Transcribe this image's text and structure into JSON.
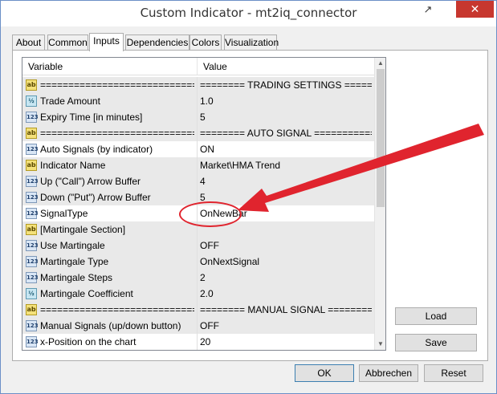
{
  "window": {
    "title": "Custom Indicator - mt2iq_connector",
    "pin_glyph": "↗",
    "close_glyph": "✕"
  },
  "tabs": [
    {
      "label": "About"
    },
    {
      "label": "Common"
    },
    {
      "label": "Inputs"
    },
    {
      "label": "Dependencies"
    },
    {
      "label": "Colors"
    },
    {
      "label": "Visualization"
    }
  ],
  "active_tab": "Inputs",
  "grid": {
    "headers": {
      "variable": "Variable",
      "value": "Value"
    },
    "rows": [
      {
        "icon": "ab",
        "icon_name": "text-type-icon",
        "variable": "================================",
        "value": "======== TRADING SETTINGS ========"
      },
      {
        "icon": "½",
        "icon_name": "double-type-icon",
        "variable": "Trade Amount",
        "value": "1.0"
      },
      {
        "icon": "123",
        "icon_name": "integer-type-icon",
        "variable": "Expiry Time [in minutes]",
        "value": "5"
      },
      {
        "icon": "ab",
        "icon_name": "text-type-icon",
        "variable": "================================",
        "value": "======== AUTO SIGNAL ==============="
      },
      {
        "icon": "123",
        "icon_name": "integer-type-icon",
        "variable": "Auto Signals (by indicator)",
        "value": "ON"
      },
      {
        "icon": "ab",
        "icon_name": "text-type-icon",
        "variable": "Indicator Name",
        "value": "Market\\HMA Trend"
      },
      {
        "icon": "123",
        "icon_name": "integer-type-icon",
        "variable": "Up (\"Call\") Arrow Buffer",
        "value": "4"
      },
      {
        "icon": "123",
        "icon_name": "integer-type-icon",
        "variable": "Down (\"Put\") Arrow Buffer",
        "value": "5"
      },
      {
        "icon": "123",
        "icon_name": "integer-type-icon",
        "variable": "SignalType",
        "value": "OnNewBar"
      },
      {
        "icon": "ab",
        "icon_name": "text-type-icon",
        "variable": "[Martingale Section]",
        "value": ""
      },
      {
        "icon": "123",
        "icon_name": "integer-type-icon",
        "variable": "Use Martingale",
        "value": "OFF"
      },
      {
        "icon": "123",
        "icon_name": "integer-type-icon",
        "variable": "Martingale Type",
        "value": "OnNextSignal"
      },
      {
        "icon": "123",
        "icon_name": "integer-type-icon",
        "variable": "Martingale Steps",
        "value": "2"
      },
      {
        "icon": "½",
        "icon_name": "double-type-icon",
        "variable": "Martingale Coefficient",
        "value": "2.0"
      },
      {
        "icon": "ab",
        "icon_name": "text-type-icon",
        "variable": "================================",
        "value": "======== MANUAL SIGNAL ============="
      },
      {
        "icon": "123",
        "icon_name": "integer-type-icon",
        "variable": "Manual Signals (up/down button)",
        "value": "OFF"
      },
      {
        "icon": "123",
        "icon_name": "integer-type-icon",
        "variable": "x-Position on the chart",
        "value": "20"
      }
    ]
  },
  "buttons": {
    "load": "Load",
    "save": "Save",
    "ok": "OK",
    "cancel": "Abbrechen",
    "reset": "Reset"
  },
  "scroll_arrows": {
    "up": "▲",
    "down": "▼"
  },
  "annotation": {
    "color": "#e0242e"
  }
}
